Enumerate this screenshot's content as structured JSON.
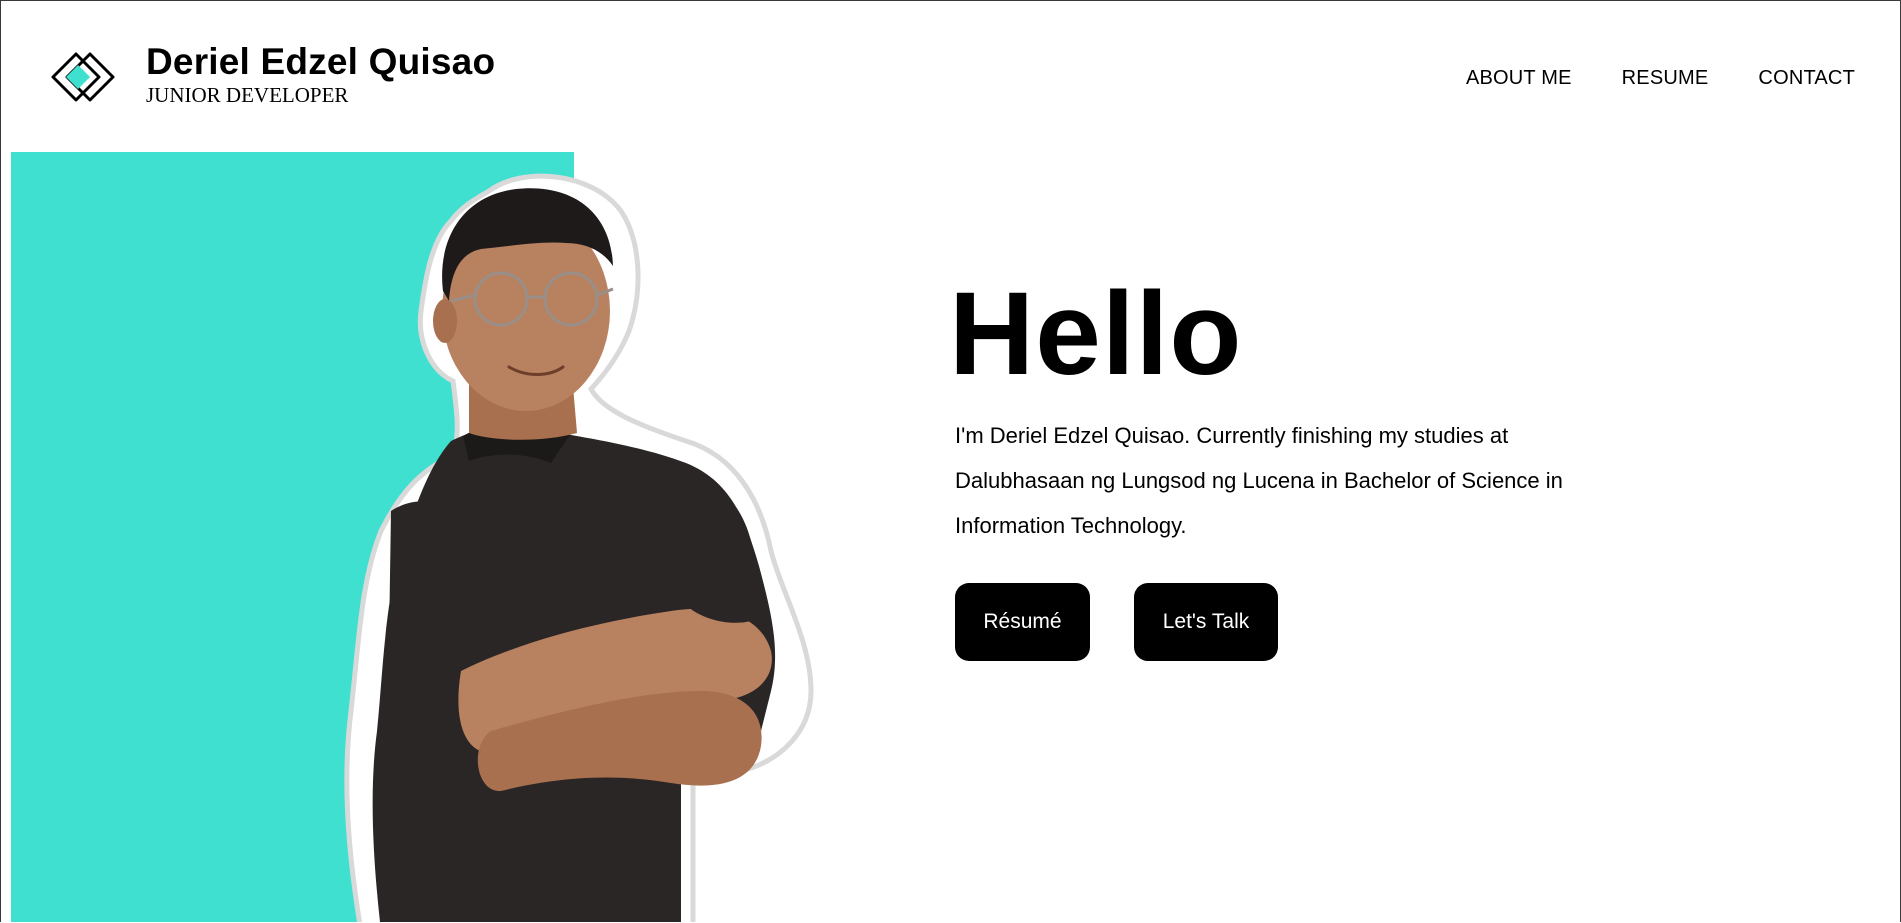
{
  "header": {
    "name": "Deriel Edzel Quisao",
    "role": "JUNIOR DEVELOPER",
    "nav": [
      {
        "label": "ABOUT ME"
      },
      {
        "label": "RESUME"
      },
      {
        "label": "CONTACT"
      }
    ]
  },
  "hero": {
    "title": "Hello",
    "intro": "I'm Deriel Edzel Quisao. Currently finishing my studies at Dalubhasaan ng Lungsod ng Lucena in Bachelor of Science in Information Technology.",
    "buttons": {
      "resume": "Résumé",
      "talk": "Let's Talk"
    }
  },
  "colors": {
    "accent": "#3fe0d0",
    "text": "#000000",
    "button_bg": "#000000",
    "button_text": "#ffffff",
    "shirt": "#2a2626",
    "skin": "#b88160"
  },
  "icons": {
    "logo": "diamond-logo-icon"
  }
}
